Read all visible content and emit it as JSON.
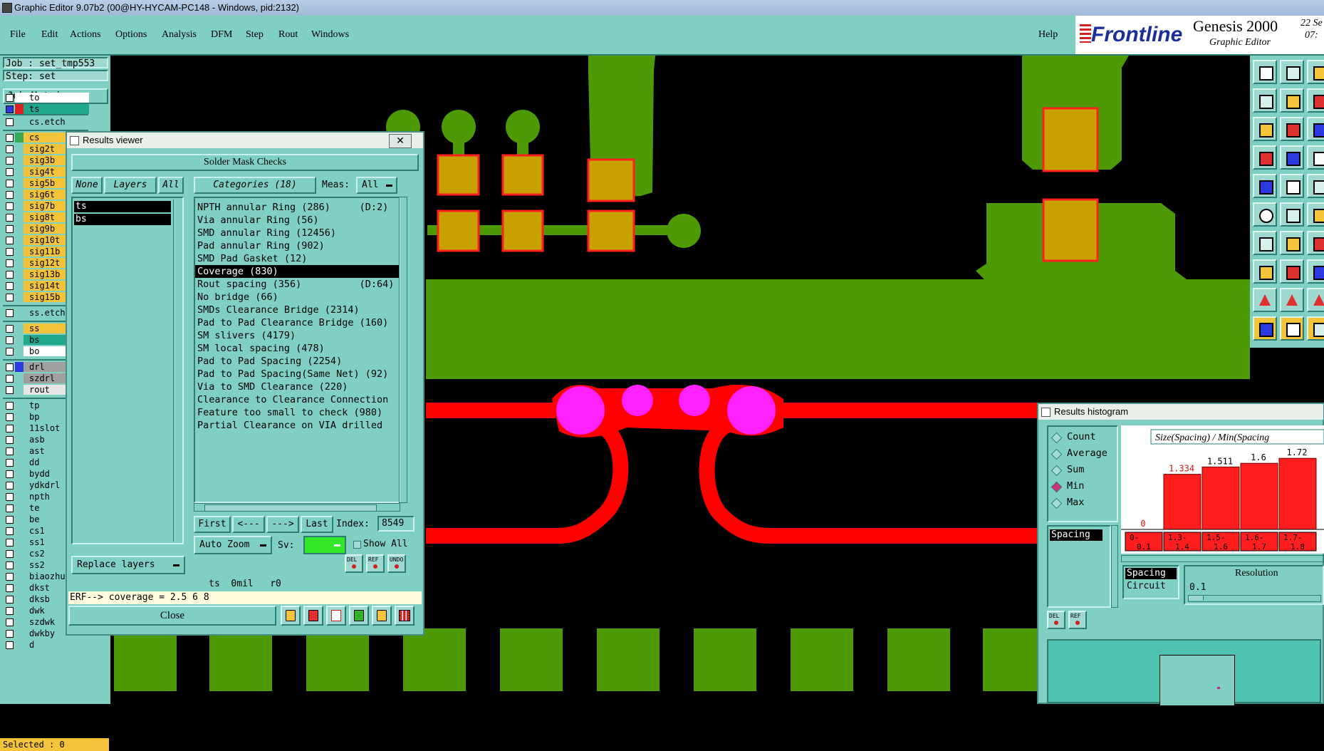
{
  "window": {
    "title": "Graphic Editor 9.07b2 (00@HY-HYCAM-PC148 - Windows, pid:2132)"
  },
  "menu": {
    "items": [
      "File",
      "Edit",
      "Actions",
      "Options",
      "Analysis",
      "DFM",
      "Step",
      "Rout",
      "Windows"
    ],
    "help": "Help"
  },
  "brand": {
    "logo": "Frontline",
    "product": "Genesis 2000",
    "subtitle": "Graphic Editor",
    "date_line1": "22 Se",
    "date_line2": "07:"
  },
  "job": {
    "job_label": "Job : set_tmp553",
    "step_label": "Step: set",
    "job_matrix": "Job Matrix ..."
  },
  "layers": [
    {
      "name": "to",
      "color": "#ffffff",
      "swatch": "#ffffff",
      "checked": false
    },
    {
      "name": "ts",
      "color": "#1fa88c",
      "swatch": "#e02020",
      "checked": true
    },
    {
      "name": "cs.etch",
      "color": "#7fcfc3",
      "swatch": "#7fcfc3",
      "checked": false
    },
    {
      "name": "cs",
      "color": "#f3c43a",
      "swatch": "#3aa85a",
      "checked": false
    },
    {
      "name": "sig2t",
      "color": "#f3c43a",
      "swatch": "#7fcfc3",
      "checked": false
    },
    {
      "name": "sig3b",
      "color": "#f3c43a",
      "swatch": "#7fcfc3",
      "checked": false
    },
    {
      "name": "sig4t",
      "color": "#f3c43a",
      "swatch": "#7fcfc3",
      "checked": false
    },
    {
      "name": "sig5b",
      "color": "#f3c43a",
      "swatch": "#7fcfc3",
      "checked": false
    },
    {
      "name": "sig6t",
      "color": "#f3c43a",
      "swatch": "#7fcfc3",
      "checked": false
    },
    {
      "name": "sig7b",
      "color": "#f3c43a",
      "swatch": "#7fcfc3",
      "checked": false
    },
    {
      "name": "sig8t",
      "color": "#f3c43a",
      "swatch": "#7fcfc3",
      "checked": false
    },
    {
      "name": "sig9b",
      "color": "#f3c43a",
      "swatch": "#7fcfc3",
      "checked": false
    },
    {
      "name": "sig10t",
      "color": "#f3c43a",
      "swatch": "#7fcfc3",
      "checked": false
    },
    {
      "name": "sig11b",
      "color": "#f3c43a",
      "swatch": "#7fcfc3",
      "checked": false
    },
    {
      "name": "sig12t",
      "color": "#f3c43a",
      "swatch": "#7fcfc3",
      "checked": false
    },
    {
      "name": "sig13b",
      "color": "#f3c43a",
      "swatch": "#7fcfc3",
      "checked": false
    },
    {
      "name": "sig14t",
      "color": "#f3c43a",
      "swatch": "#7fcfc3",
      "checked": false
    },
    {
      "name": "sig15b",
      "color": "#f3c43a",
      "swatch": "#7fcfc3",
      "checked": false
    },
    {
      "name": "ss.etch",
      "color": "#7fcfc3",
      "swatch": "#7fcfc3",
      "checked": false
    },
    {
      "name": "ss",
      "color": "#f3c43a",
      "swatch": "#7fcfc3",
      "checked": false
    },
    {
      "name": "bs",
      "color": "#1fa88c",
      "swatch": "#7fcfc3",
      "checked": false
    },
    {
      "name": "bo",
      "color": "#ffffff",
      "swatch": "#7fcfc3",
      "checked": false
    },
    {
      "name": "drl",
      "color": "#a0a0a0",
      "swatch": "#2a3ae0",
      "checked": false
    },
    {
      "name": "szdrl",
      "color": "#a0a0a0",
      "swatch": "#7fcfc3",
      "checked": false
    },
    {
      "name": "rout",
      "color": "#e6e6e6",
      "swatch": "#7fcfc3",
      "checked": false
    },
    {
      "name": "tp",
      "color": "#7fcfc3",
      "swatch": "#7fcfc3",
      "checked": false
    },
    {
      "name": "bp",
      "color": "#7fcfc3",
      "swatch": "#7fcfc3",
      "checked": false
    },
    {
      "name": "11slot",
      "color": "#7fcfc3",
      "swatch": "#7fcfc3",
      "checked": false
    },
    {
      "name": "asb",
      "color": "#7fcfc3",
      "swatch": "#7fcfc3",
      "checked": false
    },
    {
      "name": "ast",
      "color": "#7fcfc3",
      "swatch": "#7fcfc3",
      "checked": false
    },
    {
      "name": "dd",
      "color": "#7fcfc3",
      "swatch": "#7fcfc3",
      "checked": false
    },
    {
      "name": "bydd",
      "color": "#7fcfc3",
      "swatch": "#7fcfc3",
      "checked": false
    },
    {
      "name": "ydkdrl",
      "color": "#7fcfc3",
      "swatch": "#7fcfc3",
      "checked": false
    },
    {
      "name": "npth",
      "color": "#7fcfc3",
      "swatch": "#7fcfc3",
      "checked": false
    },
    {
      "name": "te",
      "color": "#7fcfc3",
      "swatch": "#7fcfc3",
      "checked": false
    },
    {
      "name": "be",
      "color": "#7fcfc3",
      "swatch": "#7fcfc3",
      "checked": false
    },
    {
      "name": "cs1",
      "color": "#7fcfc3",
      "swatch": "#7fcfc3",
      "checked": false
    },
    {
      "name": "ss1",
      "color": "#7fcfc3",
      "swatch": "#7fcfc3",
      "checked": false
    },
    {
      "name": "cs2",
      "color": "#7fcfc3",
      "swatch": "#7fcfc3",
      "checked": false
    },
    {
      "name": "ss2",
      "color": "#7fcfc3",
      "swatch": "#7fcfc3",
      "checked": false
    },
    {
      "name": "biaozhu",
      "color": "#7fcfc3",
      "swatch": "#7fcfc3",
      "checked": false
    },
    {
      "name": "dkst",
      "color": "#7fcfc3",
      "swatch": "#7fcfc3",
      "checked": false
    },
    {
      "name": "dksb",
      "color": "#7fcfc3",
      "swatch": "#7fcfc3",
      "checked": false
    },
    {
      "name": "dwk",
      "color": "#7fcfc3",
      "swatch": "#7fcfc3",
      "checked": false
    },
    {
      "name": "szdwk",
      "color": "#7fcfc3",
      "swatch": "#7fcfc3",
      "checked": false
    },
    {
      "name": "dwkby",
      "color": "#7fcfc3",
      "swatch": "#7fcfc3",
      "checked": false
    },
    {
      "name": "d",
      "color": "#7fcfc3",
      "swatch": "#7fcfc3",
      "checked": false
    }
  ],
  "selected_status": "Selected : 0",
  "viewer": {
    "title": "Results viewer",
    "close_glyph": "✕",
    "heading": "Solder Mask Checks",
    "none_btn": "None",
    "layers_btn": "Layers",
    "all_btn": "All",
    "layer_items": [
      "ts",
      "bs"
    ],
    "categories_btn": "Categories (18)",
    "meas_label": "Meas:",
    "meas_value": "All",
    "categories": [
      "NPTH annular Ring (286)     (D:2)",
      "Via annular Ring (56)",
      "SMD annular Ring (12456)",
      "Pad annular Ring (902)",
      "SMD Pad Gasket (12)",
      "Coverage (830)",
      "Rout spacing (356)          (D:64)",
      "No bridge (66)",
      "SMDs Clearance Bridge (2314)",
      "Pad to Pad Clearance Bridge (160)",
      "SM slivers (4179)",
      "SM local spacing (478)",
      "Pad to Pad Spacing (2254)",
      "Pad to Pad Spacing(Same Net) (92)",
      "Via to SMD Clearance (220)",
      "Clearance to Clearance Connection",
      "Feature too small to check (980)",
      "Partial Clearance on VIA drilled"
    ],
    "selected_index": 5,
    "first_btn": "First",
    "prev_btn": "<---",
    "next_btn": "--->",
    "last_btn": "Last",
    "index_label": "Index:",
    "index_value": "8549",
    "autozoom_btn": "Auto Zoom",
    "sv_label": "Sv:",
    "showall_label": "Show All",
    "replace_btn": "Replace layers",
    "del_label": "DEL",
    "ref_label": "REF",
    "undo_label": "UNDO",
    "status_line": "ts  0mil   r0",
    "erf_line": "ERF--> coverage = 2.5 6 8",
    "close_btn": "Close"
  },
  "histogram": {
    "title": "Results histogram",
    "options": [
      "Count",
      "Average",
      "Sum",
      "Min",
      "Max"
    ],
    "selected_option": "Min",
    "list_item": "Spacing",
    "chart_title": "Size(Spacing) / Min(Spacing",
    "bars": [
      {
        "bin": "0-0.1",
        "value": 0,
        "label": "0"
      },
      {
        "bin": "1.3-1.4",
        "value": 1.334,
        "label": "1.334"
      },
      {
        "bin": "1.5-1.6",
        "value": 1.511,
        "label": "1.511"
      },
      {
        "bin": "1.6-1.7",
        "value": 1.6,
        "label": "1.6"
      },
      {
        "bin": "1.7-1.8",
        "value": 1.72,
        "label": "1.72"
      }
    ],
    "lower_list": [
      "Spacing",
      "Circuit"
    ],
    "resolution_label": "Resolution",
    "resolution_value": "0.1",
    "del_label": "DEL",
    "ref_label": "REF"
  },
  "colors": {
    "panel": "#7fcfc3",
    "copper": "#4e9a06",
    "mask": "#ff0000",
    "pad": "#c8a000",
    "drill": "#ff22ff"
  }
}
